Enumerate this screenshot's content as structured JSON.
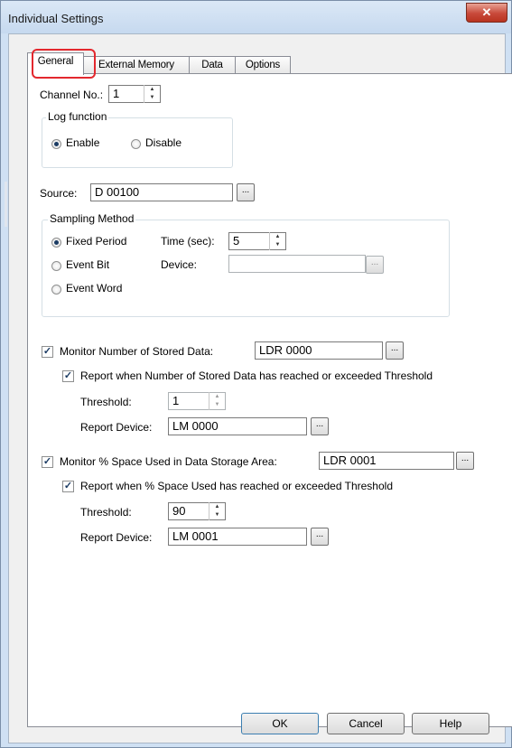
{
  "window": {
    "title": "Individual Settings",
    "close_glyph": "✕"
  },
  "tabs": [
    {
      "label": "General",
      "active": true
    },
    {
      "label": "External Memory",
      "active": false
    },
    {
      "label": "Data",
      "active": false
    },
    {
      "label": "Options",
      "active": false
    }
  ],
  "general": {
    "channel_label": "Channel No.:",
    "channel_value": "1",
    "log_function": {
      "legend": "Log function",
      "enable_label": "Enable",
      "disable_label": "Disable",
      "selected": "Enable"
    },
    "source_label": "Source:",
    "source_value": "D 00100",
    "sampling": {
      "legend": "Sampling Method",
      "fixed_label": "Fixed Period",
      "event_bit_label": "Event Bit",
      "event_word_label": "Event Word",
      "selected": "Fixed Period",
      "time_label": "Time (sec):",
      "time_value": "5",
      "device_label": "Device:",
      "device_value": ""
    },
    "monitor_stored": {
      "checked": true,
      "label": "Monitor Number of Stored Data:",
      "value": "LDR 0000",
      "report_checked": true,
      "report_label": "Report when Number of Stored Data has reached or exceeded Threshold",
      "threshold_label": "Threshold:",
      "threshold_value": "1",
      "report_device_label": "Report Device:",
      "report_device_value": "LM 0000"
    },
    "monitor_space": {
      "checked": true,
      "label": "Monitor % Space Used in Data Storage Area:",
      "value": "LDR 0001",
      "report_checked": true,
      "report_label": "Report when % Space Used has reached or exceeded Threshold",
      "threshold_label": "Threshold:",
      "threshold_value": "90",
      "report_device_label": "Report Device:",
      "report_device_value": "LM 0001"
    }
  },
  "buttons": {
    "ok": "OK",
    "cancel": "Cancel",
    "help": "Help",
    "ellipsis": "..."
  },
  "colors": {
    "highlight": "#e3282e",
    "close_button": "#c8493a",
    "titlebar": "#c6d9ef"
  }
}
